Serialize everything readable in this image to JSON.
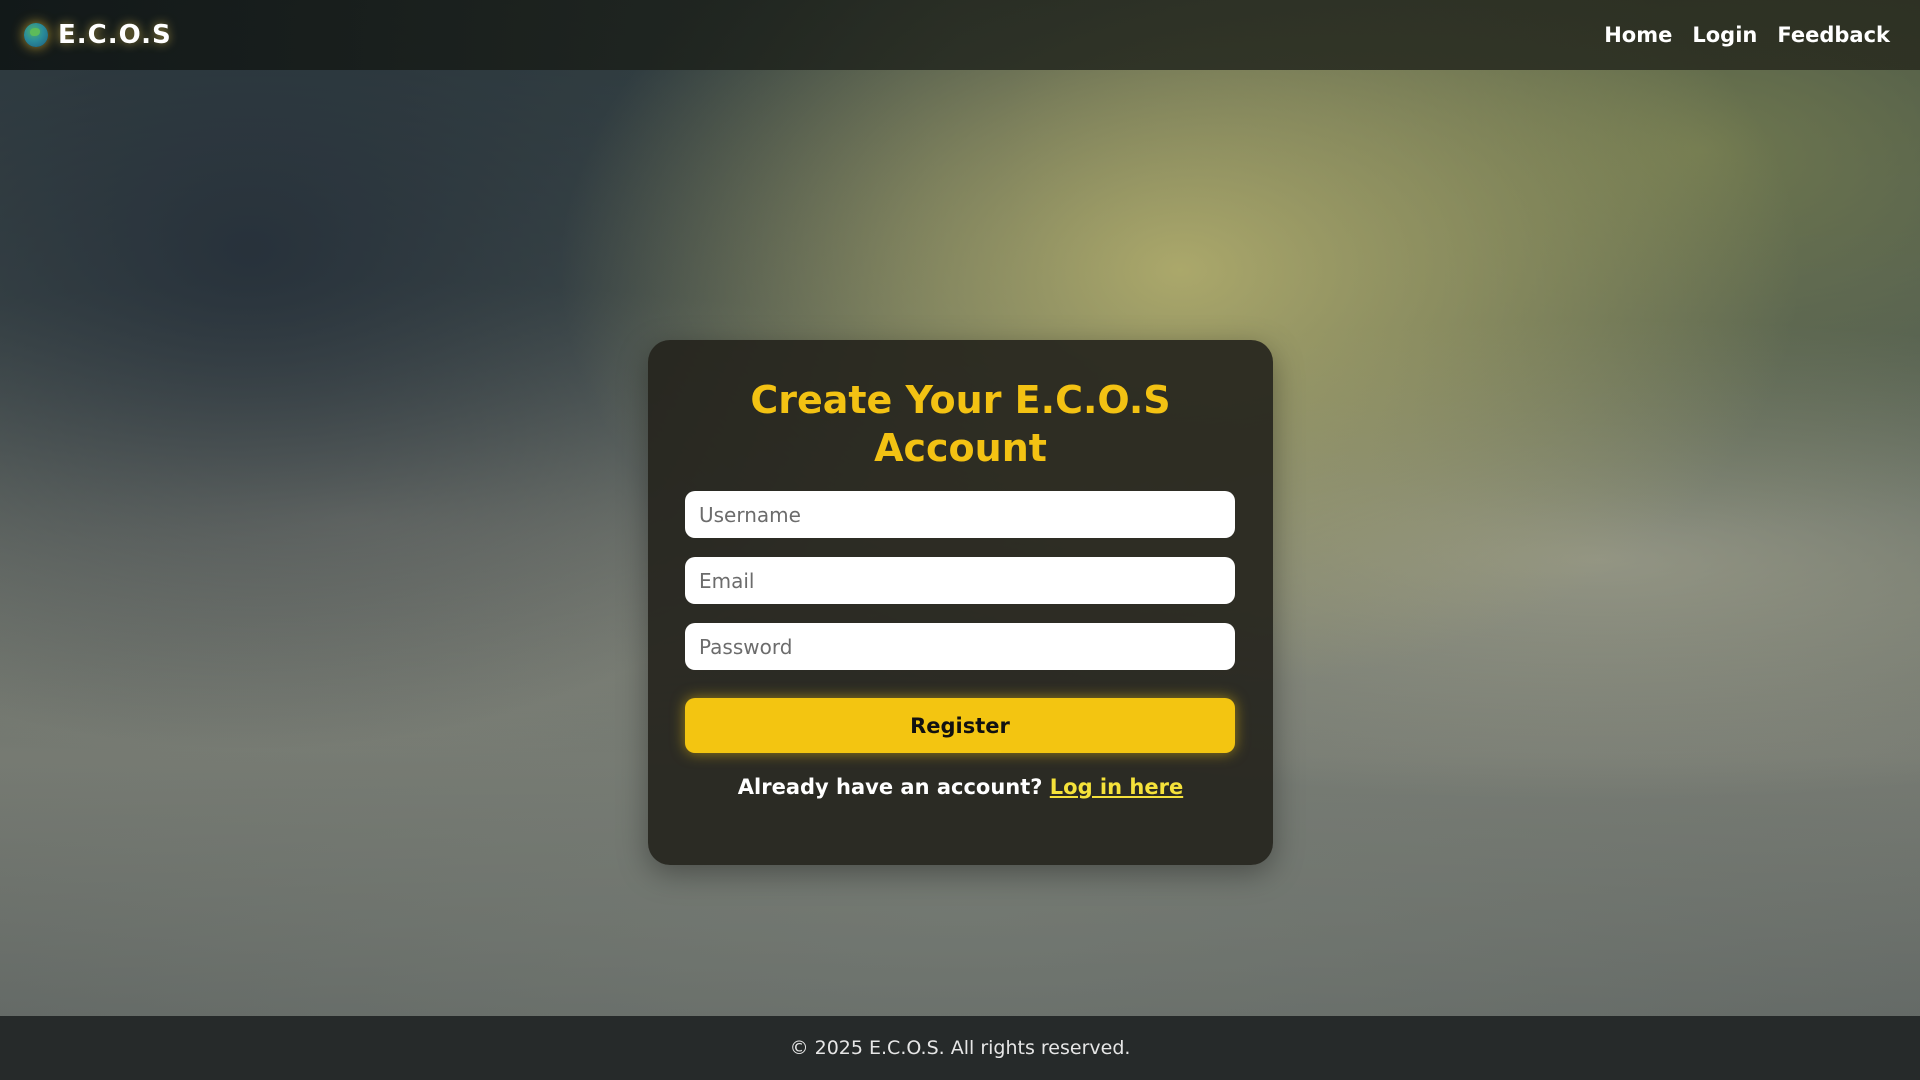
{
  "brand": {
    "icon": "globe-icon",
    "name": "E.C.O.S"
  },
  "nav": {
    "items": [
      "Home",
      "Login",
      "Feedback"
    ]
  },
  "form": {
    "title": "Create Your E.C.O.S Account",
    "username_placeholder": "Username",
    "email_placeholder": "Email",
    "password_placeholder": "Password",
    "submit_label": "Register",
    "login_prompt": "Already have an account?",
    "login_link": "Log in here"
  },
  "footer": {
    "text": "© 2025 E.C.O.S. All rights reserved."
  },
  "colors": {
    "accent": "#f3c511",
    "title": "#f3c213",
    "link": "#f5e23a"
  }
}
